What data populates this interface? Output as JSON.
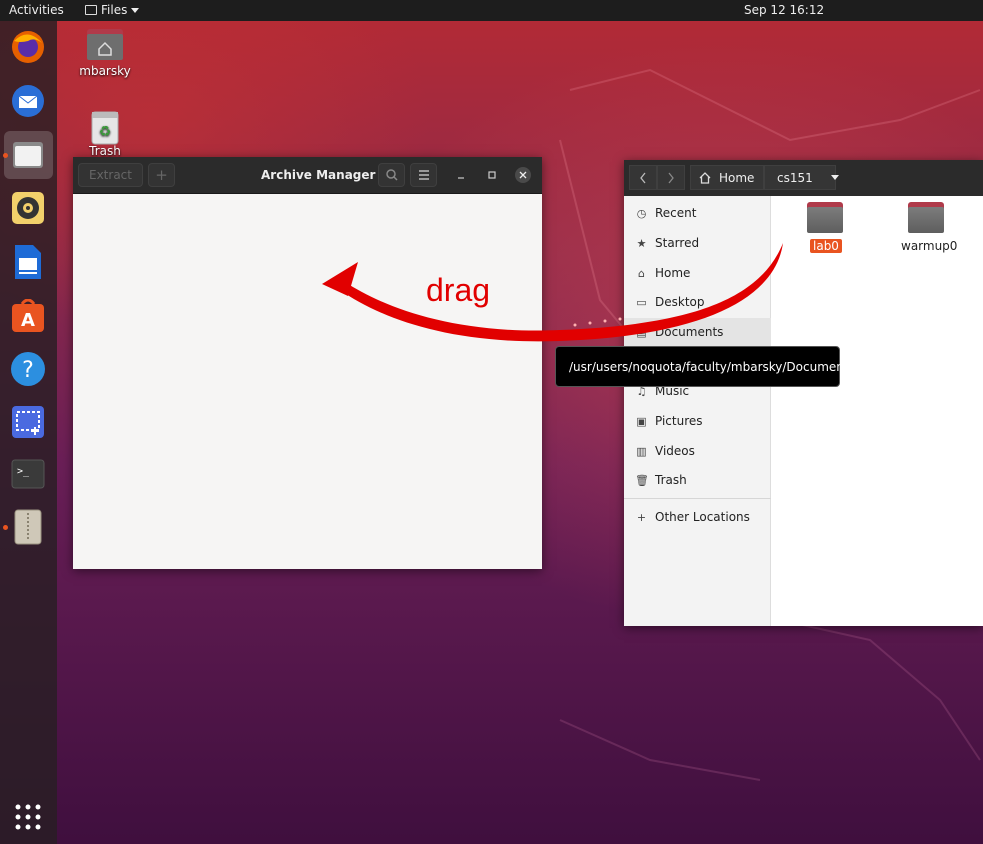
{
  "topbar": {
    "activities": "Activities",
    "app_menu": "Files",
    "clock": "Sep 12  16:12"
  },
  "dock": {
    "items": [
      "firefox-icon",
      "thunderbird-icon",
      "files-icon",
      "rhythmbox-icon",
      "writer-icon",
      "software-icon",
      "help-icon",
      "screenshot-icon",
      "terminal-icon",
      "archive-manager-icon"
    ],
    "show_apps": "apps-grid-icon"
  },
  "desktop": {
    "home_label": "mbarsky",
    "trash_label": "Trash"
  },
  "archive_manager": {
    "title": "Archive Manager",
    "extract_label": "Extract",
    "add_label": "+"
  },
  "files": {
    "path": {
      "home": "Home",
      "current": "cs151"
    },
    "sidebar": [
      {
        "label": "Recent",
        "icon": "recent-icon"
      },
      {
        "label": "Starred",
        "icon": "star-icon"
      },
      {
        "label": "Home",
        "icon": "home-icon"
      },
      {
        "label": "Desktop",
        "icon": "desktop-icon"
      },
      {
        "label": "Documents",
        "icon": "documents-icon"
      },
      {
        "label": "Music",
        "icon": "music-icon"
      },
      {
        "label": "Pictures",
        "icon": "pictures-icon"
      },
      {
        "label": "Videos",
        "icon": "videos-icon"
      },
      {
        "label": "Trash",
        "icon": "trash-icon"
      },
      {
        "label": "Other Locations",
        "icon": "plus-icon"
      }
    ],
    "folders": [
      "lab0",
      "warmup0"
    ],
    "tooltip": "/usr/users/noquota/faculty/mbarsky/Documents"
  },
  "annotation": {
    "drag_label": "drag",
    "color": "#e10000"
  }
}
